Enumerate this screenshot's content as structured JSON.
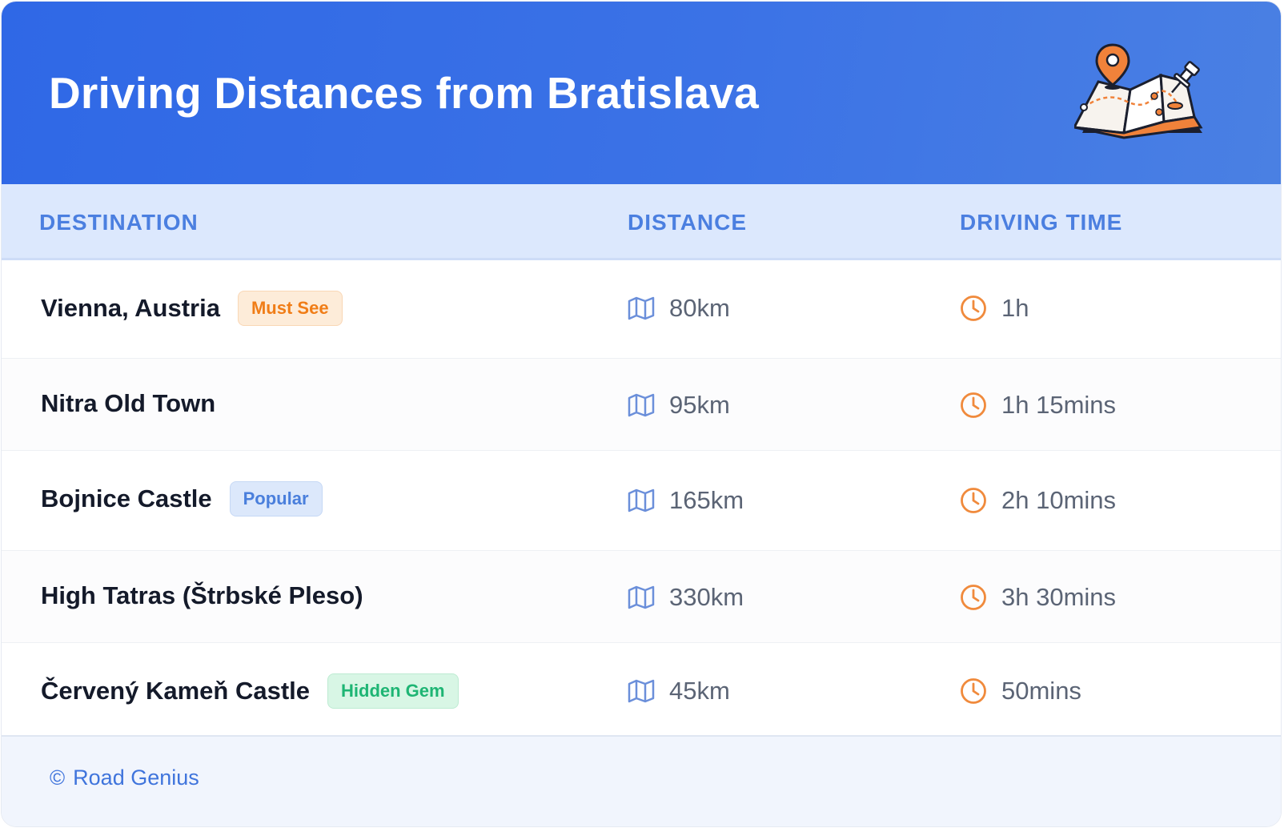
{
  "header": {
    "title": "Driving Distances from Bratislava",
    "illustration_icon": "folded-map-with-pin-icon"
  },
  "columns": {
    "destination": "DESTINATION",
    "distance": "DISTANCE",
    "driving_time": "DRIVING TIME"
  },
  "rows": [
    {
      "destination": "Vienna, Austria",
      "badge": "Must See",
      "badge_color": "#f07d17",
      "distance": "80km",
      "time": "1h"
    },
    {
      "destination": "Nitra Old Town",
      "badge": "",
      "distance": "95km",
      "time": "1h 15mins"
    },
    {
      "destination": "Bojnice Castle",
      "badge": "Popular",
      "badge_color": "#4a7fdc",
      "distance": "165km",
      "time": "2h 10mins"
    },
    {
      "destination": "High Tatras (Štrbské Pleso)",
      "badge": "",
      "distance": "330km",
      "time": "3h 30mins"
    },
    {
      "destination": "Červený Kameň Castle",
      "badge": "Hidden Gem",
      "badge_color": "#1eb574",
      "distance": "45km",
      "time": "50mins"
    }
  ],
  "icons": {
    "distance": "map-icon",
    "time": "clock-icon"
  },
  "footer": {
    "copyright_symbol": "©",
    "brand": "Road Genius"
  },
  "colors": {
    "header_blue": "#2f68e6",
    "accent_orange": "#f08a3c",
    "column_label_blue": "#4b7fe0"
  }
}
